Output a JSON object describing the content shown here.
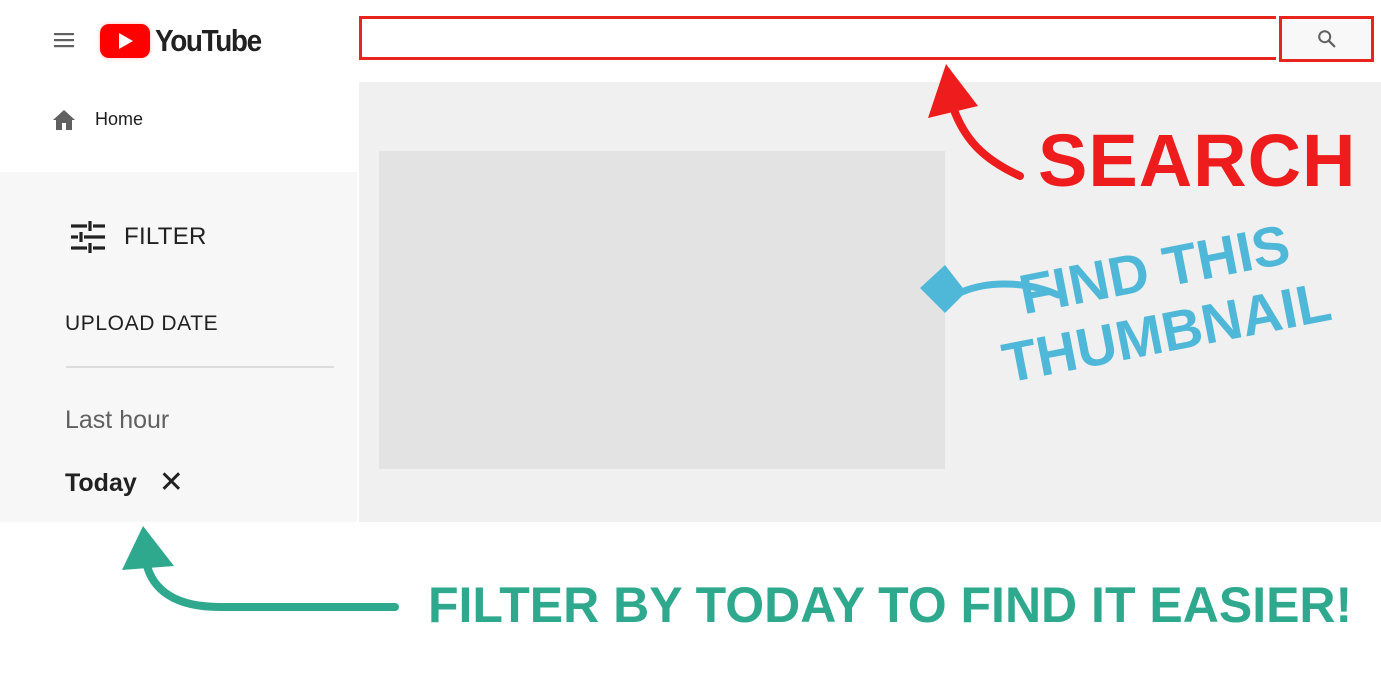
{
  "header": {
    "logo_text": "YouTube",
    "search": {
      "value": "",
      "placeholder": ""
    }
  },
  "sidebar": {
    "home_label": "Home",
    "filter_label": "FILTER",
    "upload_date_heading": "UPLOAD DATE",
    "options": [
      {
        "label": "Last hour",
        "selected": false
      },
      {
        "label": "Today",
        "selected": true
      }
    ]
  },
  "annotations": {
    "search": "SEARCH",
    "find_thumbnail_line1": "FIND THIS",
    "find_thumbnail_line2": "THUMBNAIL",
    "filter_tip": "FILTER BY TODAY TO FIND IT EASIER!"
  },
  "colors": {
    "brand_red": "#ff0000",
    "search_annotation": "#ee1c1c",
    "thumbnail_annotation": "#4fb8d8",
    "filter_annotation": "#2fa98d"
  },
  "icons": [
    "menu-icon",
    "youtube-play-icon",
    "search-icon",
    "home-icon",
    "filter-sliders-icon",
    "close-icon"
  ]
}
